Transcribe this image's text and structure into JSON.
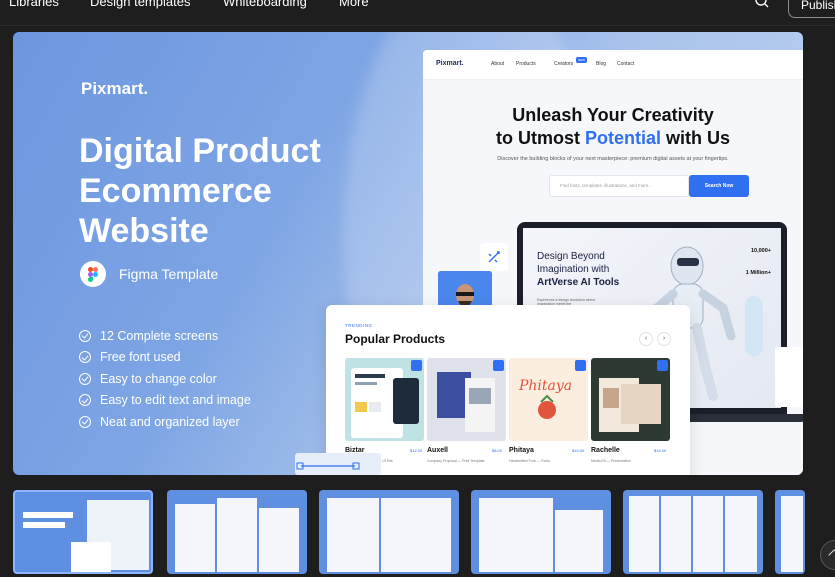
{
  "nav": {
    "items": [
      "Libraries",
      "Design templates",
      "Whiteboarding",
      "More"
    ],
    "publish_label": "Publish"
  },
  "hero": {
    "brand": "Pixmart.",
    "title": "Digital Product Ecommerce Website",
    "template_label": "Figma Template",
    "features": [
      "12 Complete screens",
      "Free font used",
      "Easy to change color",
      "Easy to edit text and image",
      "Neat and organized layer"
    ]
  },
  "site": {
    "logo": "Pixmart.",
    "links": [
      "About",
      "Products",
      "Creators",
      "Blog",
      "Contact"
    ],
    "headline_line1": "Unleash Your Creativity",
    "headline_pre": "to Utmost ",
    "headline_accent": "Potential",
    "headline_post": " with Us",
    "subtext": "Discover the building blocks of your next masterpiece: premium digital assets at your fingertips.",
    "search_placeholder": "Find fonts, templates, illustrations, and more...",
    "search_button": "Search Now"
  },
  "laptop": {
    "title_line1": "Design Beyond",
    "title_line2": "Imagination with",
    "title_bold": "ArtVerse AI Tools",
    "blurb": "Experience a design revolution where imagination meets the",
    "stat1": "10,000+",
    "stat2": "1 Million+"
  },
  "popular": {
    "kicker": "TRENDING",
    "title": "Popular Products",
    "products": [
      {
        "name": "Biztar",
        "price": "$12.00",
        "desc": "Business Consultant — UI Kits"
      },
      {
        "name": "Auxell",
        "price": "$8.00",
        "desc": "Company Proposal — Print Template"
      },
      {
        "name": "Phitaya",
        "price": "$10.00",
        "desc": "Handwritten Font — Fonts"
      },
      {
        "name": "Rachelle",
        "price": "$16.00",
        "desc": "Media Kit — Presentation"
      }
    ]
  },
  "colors": {
    "accent": "#2f6ff0",
    "hero_bg": "#7ea5e4",
    "page_bg": "#1e1e1e"
  },
  "icons": [
    "search-icon",
    "figma-icon",
    "check-circle-icon",
    "crown-icon",
    "chevron-left-icon",
    "chevron-right-icon",
    "arrow-up-icon"
  ]
}
